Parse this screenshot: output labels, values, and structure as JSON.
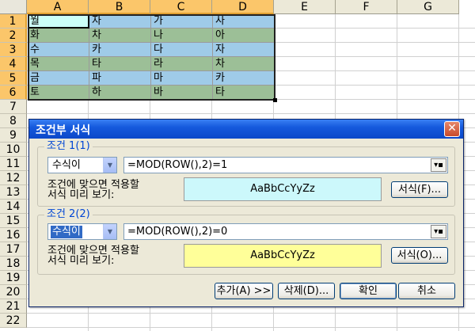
{
  "sheet": {
    "columns": [
      "A",
      "B",
      "C",
      "D",
      "E",
      "F",
      "G"
    ],
    "rows": [
      "1",
      "2",
      "3",
      "4",
      "5",
      "6",
      "7",
      "8",
      "9",
      "10",
      "11",
      "12",
      "13",
      "14",
      "15",
      "16",
      "17",
      "18",
      "19",
      "20",
      "21",
      "22"
    ],
    "cells": [
      [
        "월",
        "자",
        "가",
        "사"
      ],
      [
        "화",
        "차",
        "나",
        "아"
      ],
      [
        "수",
        "카",
        "다",
        "자"
      ],
      [
        "목",
        "타",
        "라",
        "차"
      ],
      [
        "금",
        "파",
        "마",
        "카"
      ],
      [
        "토",
        "하",
        "바",
        "타"
      ]
    ],
    "colors": {
      "odd_row": "#9fcbe8",
      "even_row": "#9cbf97",
      "active_cell": "#ccfff8",
      "selected_header": "#fbc66a"
    }
  },
  "dialog": {
    "title": "조건부 서식",
    "close_icon": "close-icon",
    "condition1": {
      "legend": "조건 1(1)",
      "type_value": "수식이",
      "formula": "=MOD(ROW(),2)=1",
      "preview_label_line1": "조건에 맞으면 적용할",
      "preview_label_line2": "서식 미리 보기:",
      "preview_text": "AaBbCcYyZz",
      "preview_bg": "#ccf8fb",
      "format_button": "서식(F)..."
    },
    "condition2": {
      "legend": "조건 2(2)",
      "type_value": "수식이",
      "formula": "=MOD(ROW(),2)=0",
      "preview_label_line1": "조건에 맞으면 적용할",
      "preview_label_line2": "서식 미리 보기:",
      "preview_text": "AaBbCcYyZz",
      "preview_bg": "#ffff99",
      "format_button": "서식(O)..."
    },
    "buttons": {
      "add": "추가(A) >>",
      "delete": "삭제(D)...",
      "ok": "확인",
      "cancel": "취소"
    }
  }
}
